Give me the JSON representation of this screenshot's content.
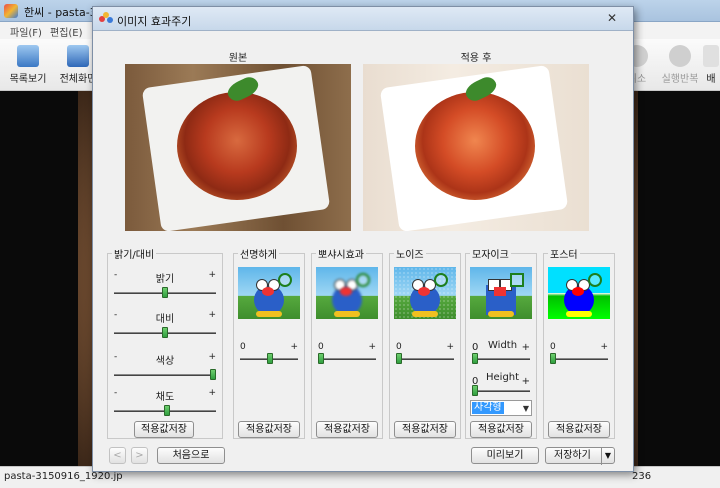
{
  "app": {
    "title": "한씨 - pasta-315(",
    "menu": [
      "파일(F)",
      "편집(E)"
    ],
    "toolbar_left": [
      {
        "label": "목록보기",
        "icon": "list-view-icon"
      },
      {
        "label": "전체화면",
        "icon": "fullscreen-icon"
      }
    ],
    "toolbar_right": [
      {
        "label": "취소",
        "icon": "undo-icon"
      },
      {
        "label": "실행반복",
        "icon": "redo-icon"
      },
      {
        "label": "배",
        "icon": "background-icon"
      }
    ],
    "status_file": "pasta-3150916_1920.jp",
    "status_right": "236"
  },
  "dialog": {
    "title": "이미지 효과주기",
    "close_glyph": "✕",
    "original_label": "원본",
    "after_label": "적용 후",
    "brightness_panel": {
      "title": "밝기/대비",
      "minus": "-",
      "plus": "+",
      "sliders": [
        {
          "name": "밝기",
          "value_pct": 50
        },
        {
          "name": "대비",
          "value_pct": 50
        },
        {
          "name": "색상",
          "value_pct": 100
        },
        {
          "name": "채도",
          "value_pct": 52
        }
      ],
      "save_label": "적용값저장"
    },
    "sharpen_panel": {
      "title": "선명하게",
      "min": "0",
      "plus": "+",
      "value_pct": 52,
      "save_label": "적용값저장"
    },
    "blur_panel": {
      "title": "뽀샤시효과",
      "min": "0",
      "plus": "+",
      "value_pct": 0,
      "save_label": "적용값저장"
    },
    "noise_panel": {
      "title": "노이즈",
      "min": "0",
      "plus": "+",
      "value_pct": 0,
      "save_label": "적용값저장"
    },
    "mosaic_panel": {
      "title": "모자이크",
      "width_min": "0",
      "width_label": "Width",
      "width_plus": "+",
      "height_min": "0",
      "height_label": "Height",
      "height_plus": "+",
      "shape_value": "사각형",
      "save_label": "적용값저장"
    },
    "poster_panel": {
      "title": "포스터",
      "min": "0",
      "plus": "+",
      "value_pct": 0,
      "save_label": "적용값저장"
    },
    "footer": {
      "prev_glyph": "<",
      "next_glyph": ">",
      "reset_label": "처음으로",
      "preview_label": "미리보기",
      "save_label": "저장하기",
      "save_dropdown_glyph": "▼"
    }
  }
}
